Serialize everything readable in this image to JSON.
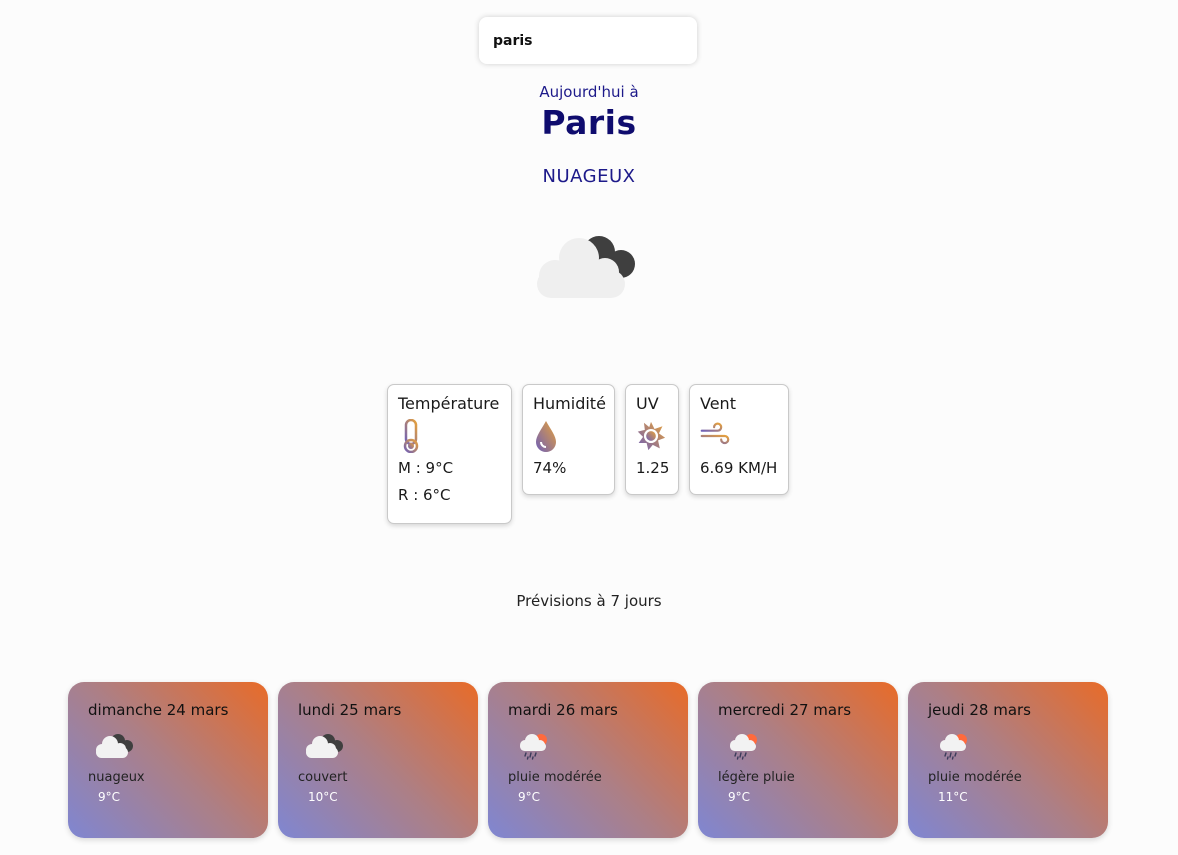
{
  "search": {
    "value": "paris"
  },
  "today": {
    "label": "Aujourd'hui à",
    "city": "Paris",
    "condition": "NUAGEUX",
    "icon": "cloudy-icon"
  },
  "stats": [
    {
      "title": "Température",
      "icon": "thermometer-icon",
      "line1": "M : 9°C",
      "line2": "R : 6°C"
    },
    {
      "title": "Humidité",
      "icon": "droplet-icon",
      "line1": "74%"
    },
    {
      "title": "UV",
      "icon": "sun-icon",
      "line1": "1.25"
    },
    {
      "title": "Vent",
      "icon": "wind-icon",
      "line1": "6.69 KM/H"
    }
  ],
  "forecast": {
    "title": "Prévisions à 7 jours",
    "days": [
      {
        "date": "dimanche 24 mars",
        "icon": "cloudy-icon",
        "desc": "nuageux",
        "temp": "9°C"
      },
      {
        "date": "lundi 25 mars",
        "icon": "cloudy-icon",
        "desc": "couvert",
        "temp": "10°C"
      },
      {
        "date": "mardi 26 mars",
        "icon": "rain-icon",
        "desc": "pluie modérée",
        "temp": "9°C"
      },
      {
        "date": "mercredi 27 mars",
        "icon": "rain-icon",
        "desc": "légère pluie",
        "temp": "9°C"
      },
      {
        "date": "jeudi 28 mars",
        "icon": "rain-icon",
        "desc": "pluie modérée",
        "temp": "11°C"
      }
    ]
  },
  "colors": {
    "heading": "#0f0c6e",
    "card_gradient": [
      "#7f86d2",
      "#ad7f85",
      "#e86b28"
    ]
  }
}
